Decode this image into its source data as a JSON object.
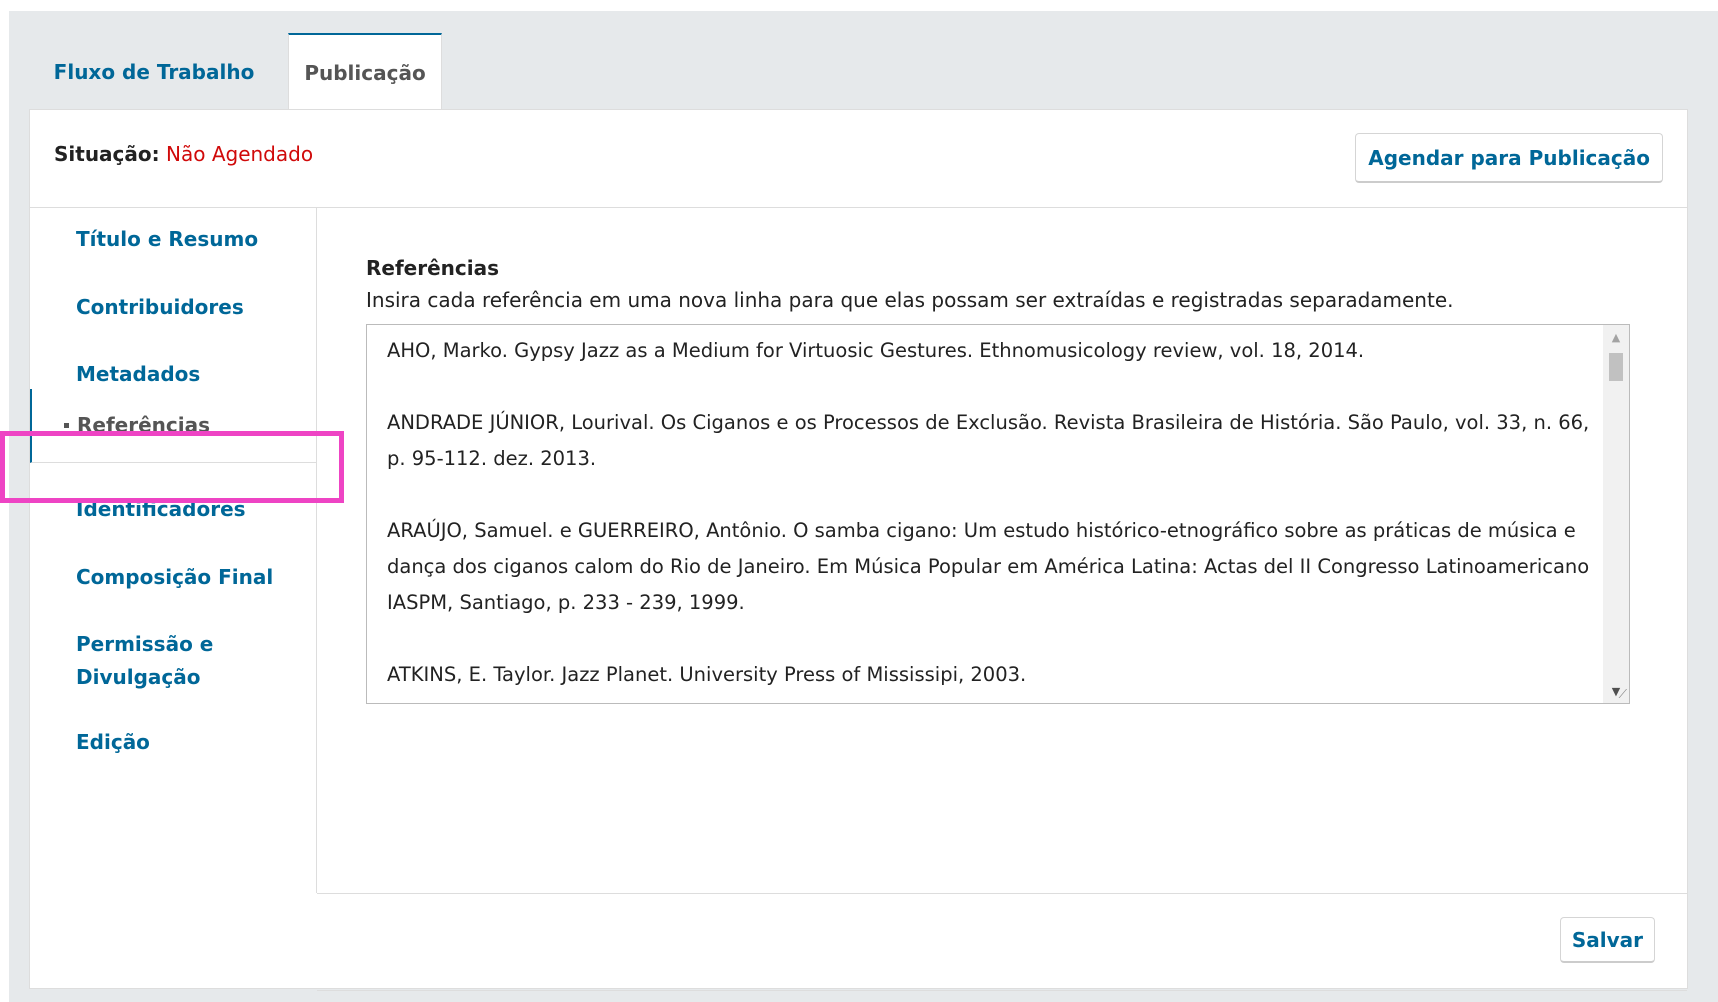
{
  "tabs": [
    {
      "label": "Fluxo de Trabalho"
    },
    {
      "label": "Publicação"
    }
  ],
  "status": {
    "label": "Situação:",
    "value": "Não Agendado",
    "value_color": "#d00a0a"
  },
  "schedule_button": "Agendar para Publicação",
  "sidenav": {
    "items": [
      {
        "label": "Título e Resumo"
      },
      {
        "label": "Contribuidores"
      },
      {
        "label": "Metadados"
      },
      {
        "label": "Referências"
      },
      {
        "label": "Identificadores"
      },
      {
        "label": "Composição Final"
      },
      {
        "label": "Permissão e Divulgação"
      },
      {
        "label": "Edição"
      }
    ],
    "active": "Referências"
  },
  "references": {
    "label": "Referências",
    "description": "Insira cada referência em uma nova linha para que elas possam ser extraídas e registradas separadamente.",
    "entries": [
      "AHO, Marko. Gypsy Jazz as a Medium for Virtuosic Gestures. Ethnomusicology review, vol. 18, 2014.",
      "ANDRADE JÚNIOR, Lourival. Os Ciganos e os Processos de Exclusão. Revista Brasileira de História. São Paulo, vol. 33, n. 66, p. 95-112. dez. 2013.",
      "ARAÚJO, Samuel. e GUERREIRO, Antônio. O samba cigano: Um estudo histórico-etnográfico sobre as práticas de música e dança dos ciganos calom do Rio de Janeiro. Em Música Popular em América Latina: Actas del II Congresso Latinoamericano IASPM, Santiago, p. 233 - 239, 1999.",
      "ATKINS, E. Taylor.  Jazz Planet. University Press of Mississipi, 2003."
    ]
  },
  "save_button": "Salvar",
  "colors": {
    "link": "#006798",
    "highlight": "#ee44c4",
    "background": "#e6e9eb"
  }
}
